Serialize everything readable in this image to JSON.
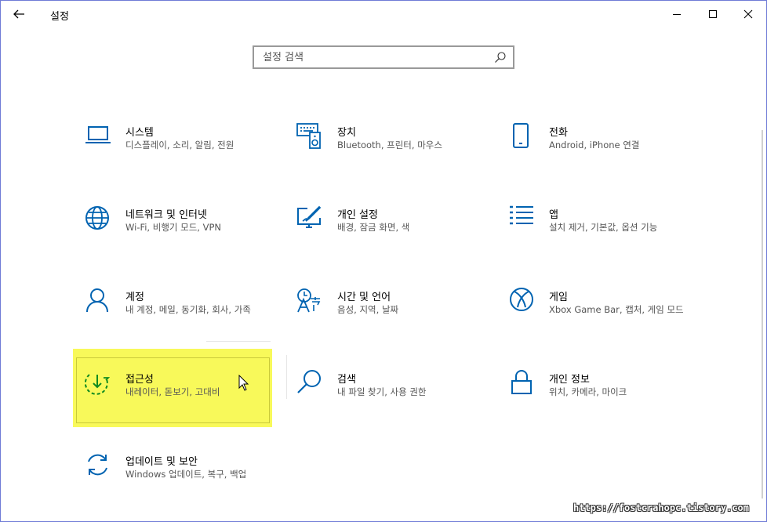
{
  "window": {
    "title": "설정"
  },
  "search": {
    "placeholder": "설정 검색"
  },
  "tiles": [
    {
      "title": "시스템",
      "desc": "디스플레이, 소리, 알림, 전원",
      "icon": "laptop-icon"
    },
    {
      "title": "장치",
      "desc": "Bluetooth, 프린터, 마우스",
      "icon": "keyboard-speaker-icon"
    },
    {
      "title": "전화",
      "desc": "Android, iPhone 연결",
      "icon": "phone-icon"
    },
    {
      "title": "네트워크 및 인터넷",
      "desc": "Wi-Fi, 비행기 모드, VPN",
      "icon": "globe-icon"
    },
    {
      "title": "개인 설정",
      "desc": "배경, 잠금 화면, 색",
      "icon": "paint-monitor-icon"
    },
    {
      "title": "앱",
      "desc": "설치 제거, 기본값, 옵션 기능",
      "icon": "app-list-icon"
    },
    {
      "title": "계정",
      "desc": "내 계정, 메일, 동기화, 회사, 가족",
      "icon": "person-icon"
    },
    {
      "title": "시간 및 언어",
      "desc": "음성, 지역, 날짜",
      "icon": "time-language-icon"
    },
    {
      "title": "게임",
      "desc": "Xbox Game Bar, 캡처, 게임 모드",
      "icon": "xbox-icon"
    },
    {
      "title": "접근성",
      "desc": "내레이터, 돋보기, 고대비",
      "icon": "ease-of-access-icon"
    },
    {
      "title": "검색",
      "desc": "내 파일 찾기, 사용 권한",
      "icon": "magnifier-icon"
    },
    {
      "title": "개인 정보",
      "desc": "위치, 카메라, 마이크",
      "icon": "lock-icon"
    },
    {
      "title": "업데이트 및 보안",
      "desc": "Windows 업데이트, 복구, 백업",
      "icon": "sync-icon"
    }
  ],
  "colors": {
    "accent": "#0063b1",
    "highlight": "#f8f95a"
  },
  "watermark": "https://fostcrahopc.tistory.com"
}
